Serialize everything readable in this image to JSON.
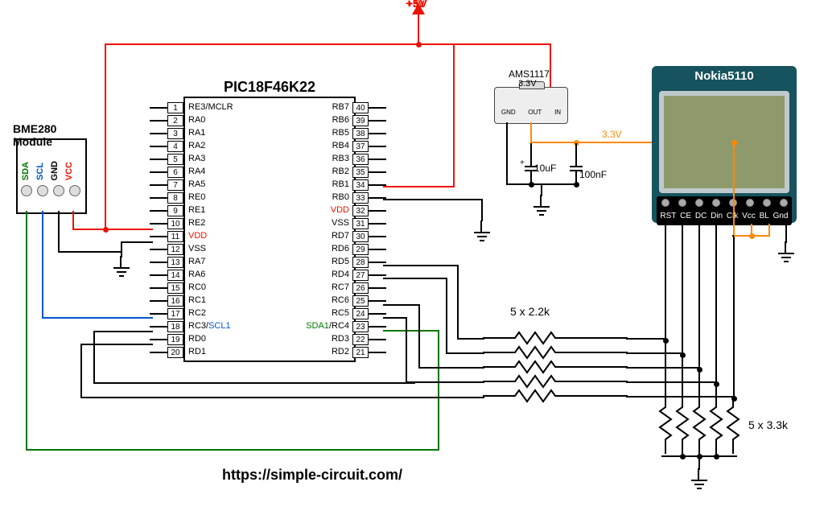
{
  "rail_label": "+5V",
  "rail_33": "3.3V",
  "mcu": {
    "name": "PIC18F46K22",
    "left_pins": [
      {
        "n": "1",
        "l": "RE3/MCLR",
        "color": ""
      },
      {
        "n": "2",
        "l": "RA0"
      },
      {
        "n": "3",
        "l": "RA1"
      },
      {
        "n": "4",
        "l": "RA2"
      },
      {
        "n": "5",
        "l": "RA3"
      },
      {
        "n": "6",
        "l": "RA4"
      },
      {
        "n": "7",
        "l": "RA5"
      },
      {
        "n": "8",
        "l": "RE0"
      },
      {
        "n": "9",
        "l": "RE1"
      },
      {
        "n": "10",
        "l": "RE2"
      },
      {
        "n": "11",
        "l": "VDD",
        "color": "red"
      },
      {
        "n": "12",
        "l": "VSS"
      },
      {
        "n": "13",
        "l": "RA7"
      },
      {
        "n": "14",
        "l": "RA6"
      },
      {
        "n": "15",
        "l": "RC0"
      },
      {
        "n": "16",
        "l": "RC1"
      },
      {
        "n": "17",
        "l": "RC2"
      },
      {
        "n": "18",
        "l": "RC3/",
        "alt": "SCL1",
        "altcolor": "blue"
      },
      {
        "n": "19",
        "l": "RD0"
      },
      {
        "n": "20",
        "l": "RD1"
      }
    ],
    "right_pins": [
      {
        "n": "40",
        "l": "RB7"
      },
      {
        "n": "39",
        "l": "RB6"
      },
      {
        "n": "38",
        "l": "RB5"
      },
      {
        "n": "37",
        "l": "RB4"
      },
      {
        "n": "36",
        "l": "RB3"
      },
      {
        "n": "35",
        "l": "RB2"
      },
      {
        "n": "34",
        "l": "RB1"
      },
      {
        "n": "33",
        "l": "RB0"
      },
      {
        "n": "32",
        "l": "VDD",
        "color": "red"
      },
      {
        "n": "31",
        "l": "VSS"
      },
      {
        "n": "30",
        "l": "RD7"
      },
      {
        "n": "29",
        "l": "RD6"
      },
      {
        "n": "28",
        "l": "RD5"
      },
      {
        "n": "27",
        "l": "RD4"
      },
      {
        "n": "26",
        "l": "RC7"
      },
      {
        "n": "25",
        "l": "RC6"
      },
      {
        "n": "24",
        "l": "RC5"
      },
      {
        "n": "23",
        "l": "/RC4",
        "alt": "SDA1",
        "altcolor": "green"
      },
      {
        "n": "22",
        "l": "RD3"
      },
      {
        "n": "21",
        "l": "RD2"
      }
    ]
  },
  "regulator": {
    "name": "AMS1117",
    "sub": "3.3V",
    "pins": [
      "GND",
      "OUT",
      "IN"
    ]
  },
  "caps": {
    "c1": "10uF",
    "c2": "100nF"
  },
  "resistors": {
    "series": "5 x 2.2k",
    "pulldown": "5 x 3.3k"
  },
  "bme": {
    "title": "BME280 Module",
    "pins": [
      "SDA",
      "SCL",
      "GND",
      "VCC"
    ]
  },
  "nokia": {
    "title": "Nokia5110",
    "pins": [
      "RST",
      "CE",
      "DC",
      "Din",
      "Clk",
      "Vcc",
      "BL",
      "Gnd"
    ]
  },
  "url": "https://simple-circuit.com/"
}
